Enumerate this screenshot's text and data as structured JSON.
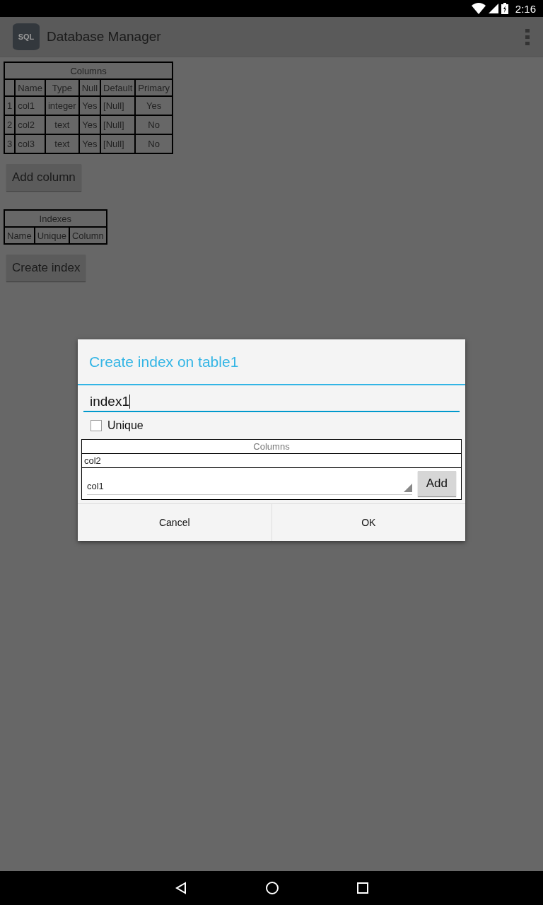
{
  "status_bar": {
    "time": "2:16"
  },
  "app_bar": {
    "title": "Database Manager",
    "logo_text": "SQL"
  },
  "columns_table": {
    "title": "Columns",
    "headers": [
      "Name",
      "Type",
      "Null",
      "Default",
      "Primary"
    ],
    "rows": [
      [
        "1",
        "col1",
        "integer",
        "Yes",
        "[Null]",
        "Yes"
      ],
      [
        "2",
        "col2",
        "text",
        "Yes",
        "[Null]",
        "No"
      ],
      [
        "3",
        "col3",
        "text",
        "Yes",
        "[Null]",
        "No"
      ]
    ]
  },
  "add_column_button": "Add column",
  "indexes_table": {
    "title": "Indexes",
    "headers": [
      "Name",
      "Unique",
      "Column"
    ]
  },
  "create_index_button": "Create index",
  "dialog": {
    "title": "Create index on table1",
    "name_value": "index1",
    "unique": {
      "label": "Unique",
      "checked": false
    },
    "columns_title": "Columns",
    "columns": [
      "col2"
    ],
    "spinner_value": "col1",
    "add_button": "Add",
    "buttons": [
      "Cancel",
      "OK"
    ]
  }
}
